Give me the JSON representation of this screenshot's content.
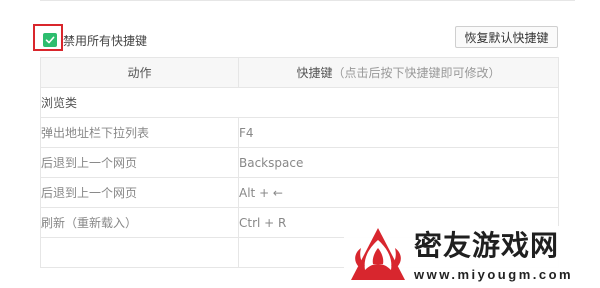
{
  "settings": {
    "disable_all_label": "禁用所有快捷键",
    "disable_all_checked": true,
    "restore_default_label": "恢复默认快捷键"
  },
  "table": {
    "header_action": "动作",
    "header_shortcut": "快捷键",
    "header_shortcut_hint": "（点击后按下快捷键即可修改）",
    "section_browse": "浏览类",
    "rows": [
      {
        "action": "弹出地址栏下拉列表",
        "key": "F4"
      },
      {
        "action": "后退到上一个网页",
        "key": "Backspace"
      },
      {
        "action": "后退到上一个网页",
        "key": "Alt + ←"
      },
      {
        "action": "刷新（重新载入）",
        "key": "Ctrl + R"
      },
      {
        "action": "",
        "key": ""
      }
    ]
  },
  "watermark": {
    "title": "密友游戏网",
    "url": "www.miyougm.com"
  },
  "colors": {
    "checkbox_green": "#2dbd6e",
    "highlight_red": "#d9262c"
  },
  "icons": {
    "checkbox": "check-icon",
    "logo": "miyou-logo-icon"
  }
}
